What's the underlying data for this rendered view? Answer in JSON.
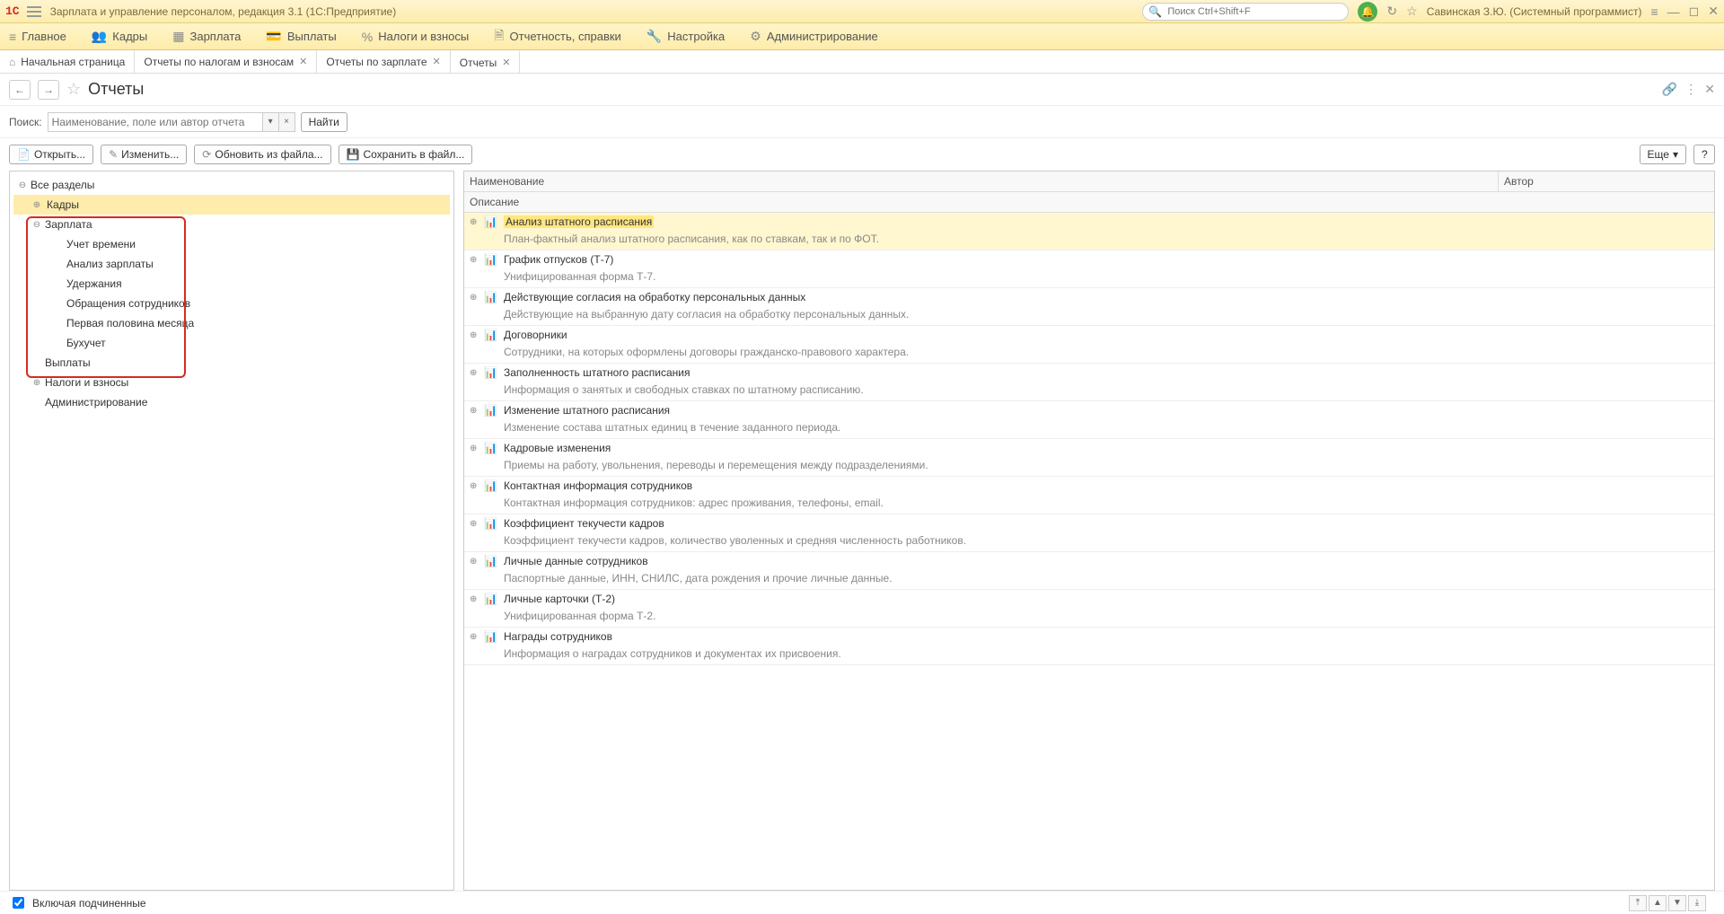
{
  "titleBar": {
    "appTitle": "Зарплата и управление персоналом, редакция 3.1  (1С:Предприятие)",
    "searchPlaceholder": "Поиск Ctrl+Shift+F",
    "userName": "Савинская З.Ю. (Системный программист)"
  },
  "mainMenu": [
    {
      "icon": "≡",
      "label": "Главное"
    },
    {
      "icon": "👥",
      "label": "Кадры"
    },
    {
      "icon": "▦",
      "label": "Зарплата"
    },
    {
      "icon": "💳",
      "label": "Выплаты"
    },
    {
      "icon": "%",
      "label": "Налоги и взносы"
    },
    {
      "icon": "🗎",
      "label": "Отчетность, справки"
    },
    {
      "icon": "🔧",
      "label": "Настройка"
    },
    {
      "icon": "⚙",
      "label": "Администрирование"
    }
  ],
  "tabs": [
    {
      "label": "Начальная страница",
      "closable": false,
      "home": true
    },
    {
      "label": "Отчеты по налогам и взносам",
      "closable": true
    },
    {
      "label": "Отчеты по зарплате",
      "closable": true
    },
    {
      "label": "Отчеты",
      "closable": true,
      "active": true
    }
  ],
  "pageTitle": "Отчеты",
  "searchRow": {
    "label": "Поиск:",
    "placeholder": "Наименование, поле или автор отчета",
    "find": "Найти"
  },
  "toolbar": {
    "open": "Открыть...",
    "edit": "Изменить...",
    "updateFromFile": "Обновить из файла...",
    "saveToFile": "Сохранить в файл...",
    "more": "Еще"
  },
  "tree": {
    "root": "Все разделы",
    "items": [
      {
        "label": "Кадры",
        "selected": true,
        "expand": "⊕"
      },
      {
        "label": "Зарплата",
        "expand": "⊖",
        "children": [
          "Учет времени",
          "Анализ зарплаты",
          "Удержания",
          "Обращения сотрудников",
          "Первая половина месяца",
          "Бухучет"
        ]
      },
      {
        "label": "Выплаты"
      },
      {
        "label": "Налоги и взносы",
        "expand": "⊕"
      },
      {
        "label": "Администрирование"
      }
    ]
  },
  "grid": {
    "headerName": "Наименование",
    "headerAuthor": "Автор",
    "headerDesc": "Описание",
    "rows": [
      {
        "title": "Анализ штатного расписания",
        "desc": "План-фактный анализ штатного расписания, как по ставкам, так и по ФОТ.",
        "selected": true
      },
      {
        "title": "График отпусков (Т-7)",
        "desc": "Унифицированная форма Т-7."
      },
      {
        "title": "Действующие согласия на обработку персональных данных",
        "desc": "Действующие на выбранную дату согласия на обработку персональных данных."
      },
      {
        "title": "Договорники",
        "desc": "Сотрудники, на которых оформлены договоры гражданско-правового характера."
      },
      {
        "title": "Заполненность штатного расписания",
        "desc": "Информация о занятых и свободных ставках по штатному расписанию."
      },
      {
        "title": "Изменение штатного расписания",
        "desc": "Изменение состава штатных единиц в течение заданного периода."
      },
      {
        "title": "Кадровые изменения",
        "desc": "Приемы на работу, увольнения, переводы и перемещения между подразделениями."
      },
      {
        "title": "Контактная информация сотрудников",
        "desc": "Контактная информация сотрудников: адрес проживания, телефоны, email."
      },
      {
        "title": "Коэффициент текучести кадров",
        "desc": "Коэффициент текучести кадров, количество уволенных и средняя численность работников."
      },
      {
        "title": "Личные данные сотрудников",
        "desc": "Паспортные данные, ИНН, СНИЛС, дата рождения и прочие личные данные."
      },
      {
        "title": "Личные карточки (Т-2)",
        "desc": "Унифицированная форма Т-2."
      },
      {
        "title": "Награды сотрудников",
        "desc": "Информация о наградах сотрудников и документах их присвоения."
      }
    ]
  },
  "footer": {
    "checkbox": "Включая подчиненные"
  }
}
